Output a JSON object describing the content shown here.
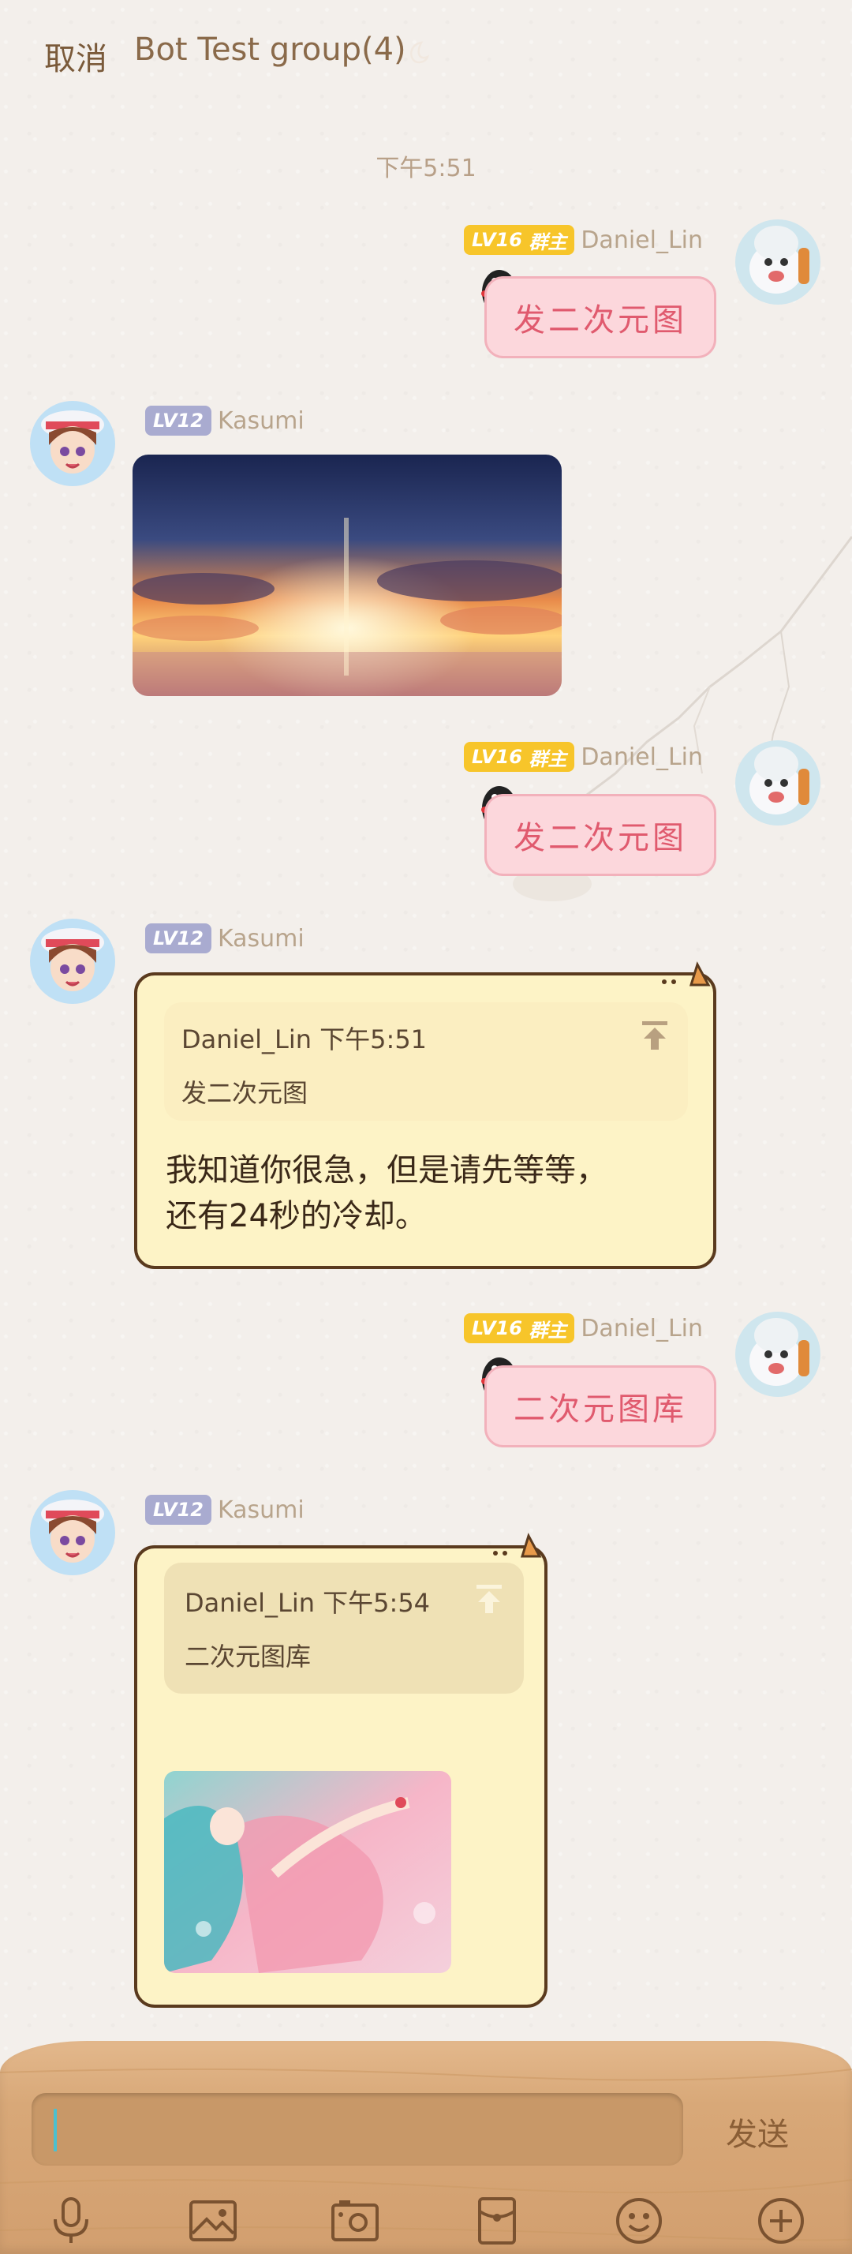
{
  "header": {
    "cancel_label": "取消",
    "title": "Bot Test group(4)"
  },
  "timestamps": [
    "下午5:51"
  ],
  "messages": [
    {
      "sender": "Daniel_Lin",
      "level": "LV16",
      "role": "群主",
      "text": "发二次元图"
    },
    {
      "sender": "Kasumi",
      "level": "LV12",
      "type": "image"
    },
    {
      "sender": "Daniel_Lin",
      "level": "LV16",
      "role": "群主",
      "text": "发二次元图"
    },
    {
      "sender": "Kasumi",
      "level": "LV12",
      "quote": {
        "sender": "Daniel_Lin",
        "time": "下午5:51",
        "text": "发二次元图"
      },
      "reply_lines": [
        "我知道你很急，但是请先等等，",
        "还有24秒的冷却。"
      ]
    },
    {
      "sender": "Daniel_Lin",
      "level": "LV16",
      "role": "群主",
      "text": "二次元图库"
    },
    {
      "sender": "Kasumi",
      "level": "LV12",
      "quote": {
        "sender": "Daniel_Lin",
        "time": "下午5:54",
        "text": "二次元图库"
      },
      "type": "image"
    }
  ],
  "composer": {
    "input_value": "",
    "send_label": "发送"
  },
  "toolbar": {
    "icons": [
      "microphone-icon",
      "image-icon",
      "camera-icon",
      "red-packet-icon",
      "emoji-icon",
      "plus-icon"
    ]
  },
  "colors": {
    "background": "#f3efeb",
    "pink_bubble": "#fcd7dc",
    "pink_text": "#e05a6e",
    "yellow_bubble": "#fdf3c6",
    "owner_badge": "#f7c52a",
    "member_badge": "#a9abd0",
    "wood": "#d8a878"
  }
}
